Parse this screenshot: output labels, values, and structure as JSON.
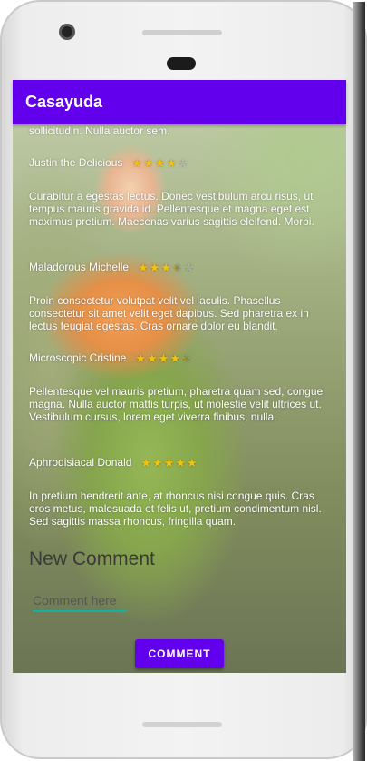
{
  "app": {
    "title": "Casayuda"
  },
  "review_top_text": "sollicitudin. Nulla auctor sem.",
  "comments": [
    {
      "author": "Justin the Delicious",
      "rating": 4,
      "text": "Curabitur a egestas lectus. Donec vestibulum arcu risus, ut tempus mauris gravida id. Pellentesque et magna eget est maximus pretium. Maecenas varius sagittis eleifend. Morbi."
    },
    {
      "author": "Maladorous Michelle",
      "rating": 3.5,
      "text": "Proin consectetur volutpat velit vel iaculis. Phasellus consectetur sit amet velit eget dapibus. Sed pharetra ex in lectus feugiat egestas. Cras ornare dolor eu blandit."
    },
    {
      "author": "Microscopic Cristine",
      "rating": 4.5,
      "text": "Pellentesque vel mauris pretium, pharetra quam sed, congue magna. Nulla auctor mattis turpis, ut molestie velit ultrices ut. Vestibulum cursus, lorem eget viverra finibus, nulla."
    },
    {
      "author": "Aphrodisiacal Donald",
      "rating": 5,
      "text": "In pretium hendrerit ante, at rhoncus nisi congue quis. Cras eros metus, malesuada et felis ut, pretium condimentum nisl. Sed sagittis massa rhoncus, fringilla quam."
    }
  ],
  "new_comment": {
    "title": "New Comment",
    "placeholder": "Comment here",
    "button_label": "COMMENT"
  },
  "colors": {
    "primary": "#6200ee",
    "star": "#f4c20d",
    "input_underline": "#11b3a0"
  }
}
